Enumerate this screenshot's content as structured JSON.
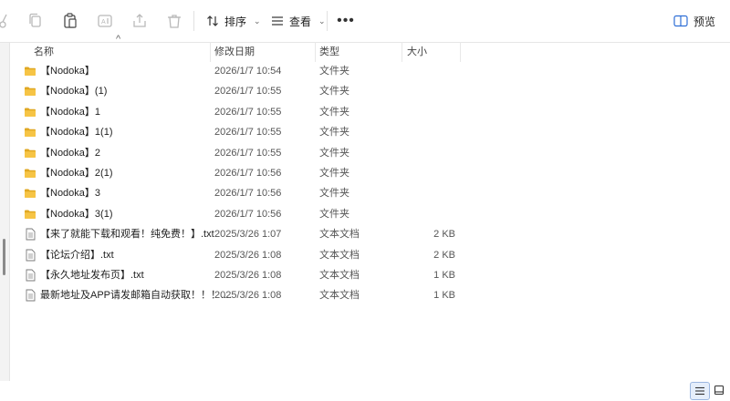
{
  "toolbar": {
    "sort_label": "排序",
    "view_label": "查看",
    "preview_label": "预览"
  },
  "columns": {
    "name": "名称",
    "date": "修改日期",
    "type": "类型",
    "size": "大小"
  },
  "files": [
    {
      "name": "【Nodoka】",
      "date": "2026/1/7 10:54",
      "type": "文件夹",
      "size": "",
      "kind": "folder"
    },
    {
      "name": "【Nodoka】(1)",
      "date": "2026/1/7 10:55",
      "type": "文件夹",
      "size": "",
      "kind": "folder"
    },
    {
      "name": "【Nodoka】1",
      "date": "2026/1/7 10:55",
      "type": "文件夹",
      "size": "",
      "kind": "folder"
    },
    {
      "name": "【Nodoka】1(1)",
      "date": "2026/1/7 10:55",
      "type": "文件夹",
      "size": "",
      "kind": "folder"
    },
    {
      "name": "【Nodoka】2",
      "date": "2026/1/7 10:55",
      "type": "文件夹",
      "size": "",
      "kind": "folder"
    },
    {
      "name": "【Nodoka】2(1)",
      "date": "2026/1/7 10:56",
      "type": "文件夹",
      "size": "",
      "kind": "folder"
    },
    {
      "name": "【Nodoka】3",
      "date": "2026/1/7 10:56",
      "type": "文件夹",
      "size": "",
      "kind": "folder"
    },
    {
      "name": "【Nodoka】3(1)",
      "date": "2026/1/7 10:56",
      "type": "文件夹",
      "size": "",
      "kind": "folder"
    },
    {
      "name": "【来了就能下载和观看！纯免费！】.txt",
      "date": "2025/3/26 1:07",
      "type": "文本文档",
      "size": "2 KB",
      "kind": "text"
    },
    {
      "name": "【论坛介绍】.txt",
      "date": "2025/3/26 1:08",
      "type": "文本文档",
      "size": "2 KB",
      "kind": "text"
    },
    {
      "name": "【永久地址发布页】.txt",
      "date": "2025/3/26 1:08",
      "type": "文本文档",
      "size": "1 KB",
      "kind": "text"
    },
    {
      "name": "最新地址及APP请发邮箱自动获取！！！....",
      "date": "2025/3/26 1:08",
      "type": "文本文档",
      "size": "1 KB",
      "kind": "text"
    }
  ],
  "colors": {
    "folder": "#f6c445",
    "folder_dark": "#e0a823",
    "accent": "#2f6fd6"
  }
}
